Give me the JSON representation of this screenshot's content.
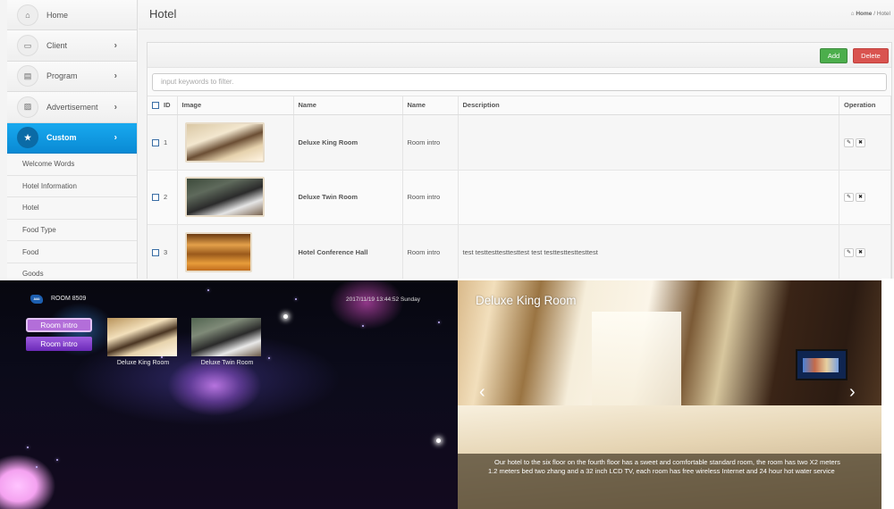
{
  "admin": {
    "sidebar": {
      "items": [
        {
          "label": "Home",
          "icon": "home-icon",
          "glyph": "⌂",
          "has_chevron": false,
          "active": false
        },
        {
          "label": "Client",
          "icon": "monitor-icon",
          "glyph": "▭",
          "has_chevron": true,
          "active": false
        },
        {
          "label": "Program",
          "icon": "film-icon",
          "glyph": "▤",
          "has_chevron": true,
          "active": false
        },
        {
          "label": "Advertisement",
          "icon": "image-icon",
          "glyph": "▨",
          "has_chevron": true,
          "active": false
        },
        {
          "label": "Custom",
          "icon": "star-icon",
          "glyph": "★",
          "has_chevron": true,
          "active": true
        }
      ],
      "chevron_glyph": "›",
      "sub_items": [
        "Welcome Words",
        "Hotel Information",
        "Hotel",
        "Food Type",
        "Food",
        "Goods"
      ]
    },
    "header": {
      "title": "Hotel",
      "breadcrumb": {
        "home_icon": "⌂",
        "home": "Home",
        "separator": "/",
        "current": "Hotel"
      }
    },
    "toolbar": {
      "add_label": "Add",
      "delete_label": "Delete",
      "add_color": "#4cae4c",
      "delete_color": "#d9534f"
    },
    "filter": {
      "placeholder": "input keywords to filter.",
      "value": ""
    },
    "table": {
      "columns": [
        "ID",
        "Image",
        "Name",
        "Name",
        "Description",
        "Operation"
      ],
      "rows": [
        {
          "id": "1",
          "image": "deluxe-king-room-thumbnail",
          "name": "Deluxe King Room",
          "name2": "Room intro",
          "description": ""
        },
        {
          "id": "2",
          "image": "deluxe-twin-room-thumbnail",
          "name": "Deluxe Twin Room",
          "name2": "Room intro",
          "description": ""
        },
        {
          "id": "3",
          "image": "hotel-conference-hall-thumbnail",
          "name": "Hotel Conference Hall",
          "name2": "Room intro",
          "description": "test testtesttesttesttest test testtesttesttesttest"
        }
      ],
      "edit_glyph": "✎",
      "delete_glyph": "✖"
    }
  },
  "tv": {
    "logo_text": "AIAI",
    "room": "ROOM 8509",
    "clock": "2017/11/19  13:44:52  Sunday",
    "menu": [
      "Room intro",
      "Room intro"
    ],
    "cards": [
      {
        "caption": "Deluxe King Room"
      },
      {
        "caption": "Deluxe Twin Room"
      }
    ]
  },
  "detail": {
    "title": "Deluxe King Room",
    "prev_glyph": "‹",
    "next_glyph": "›",
    "caption": "Our hotel to the six floor on the fourth floor has a sweet and comfortable standard room, the room has two X2 meters 1.2 meters bed two zhang and a 32 inch LCD TV, each room has free wireless Internet and 24 hour hot water service"
  }
}
